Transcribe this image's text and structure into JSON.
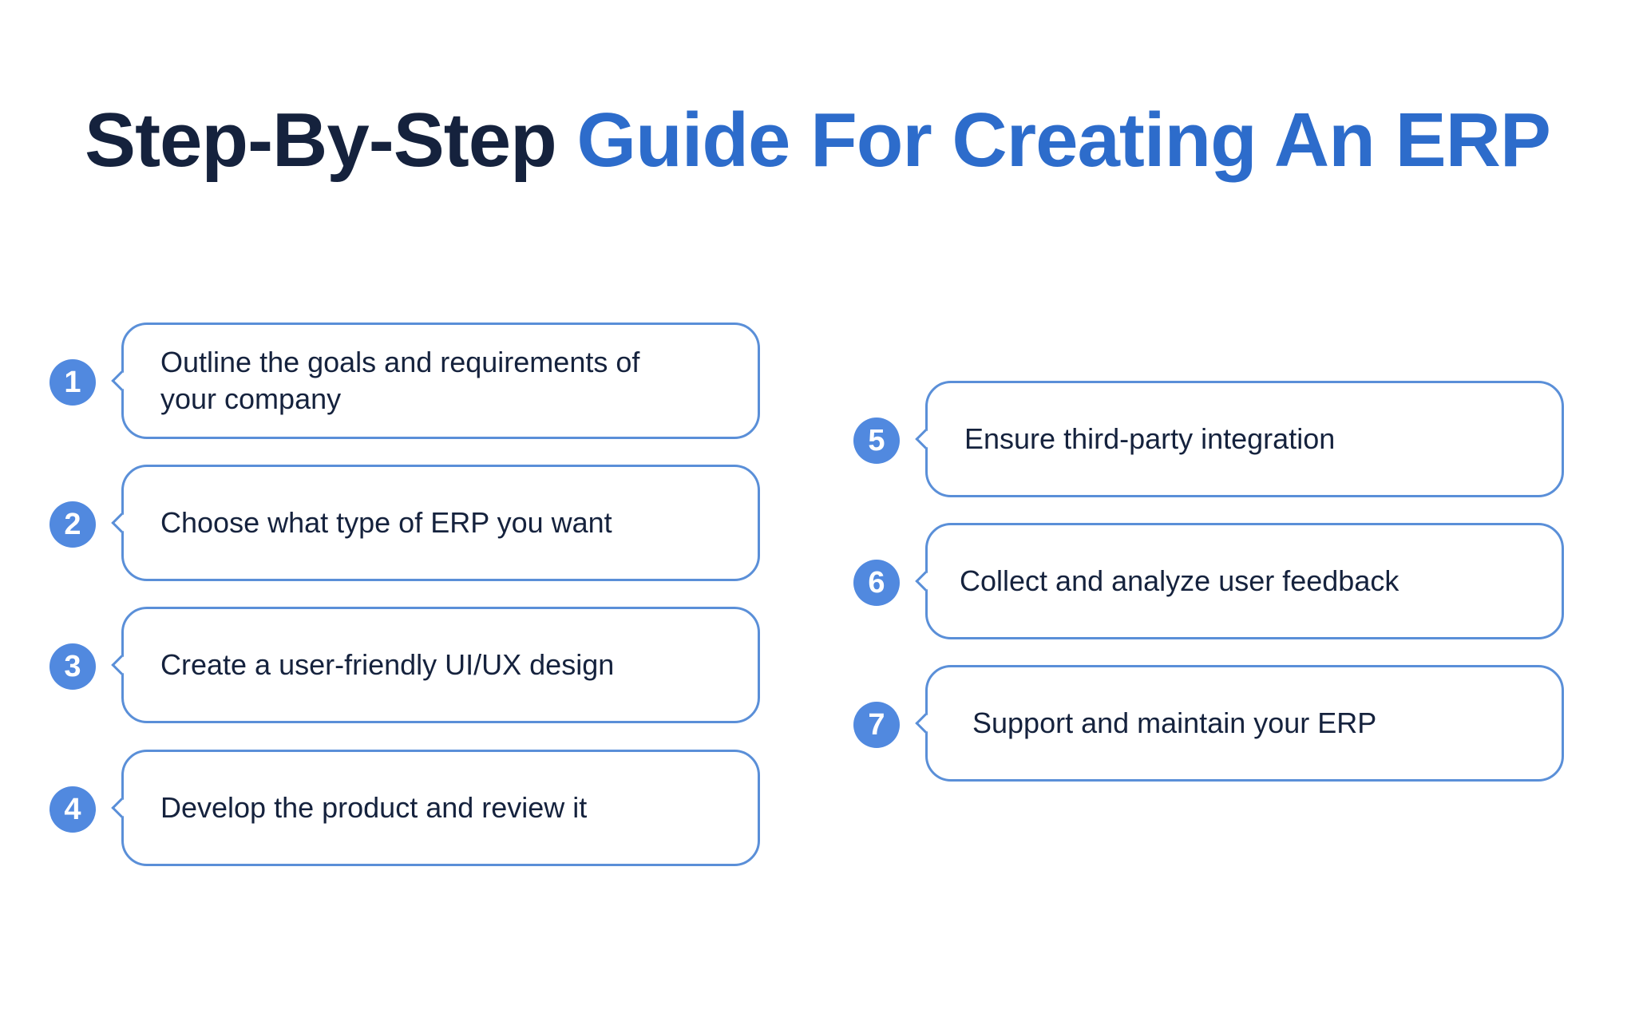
{
  "title": {
    "part1": "Step-By-Step",
    "part2": "Guide For Creating An ERP"
  },
  "colors": {
    "title_dark": "#15223d",
    "title_accent": "#2d6ccb",
    "badge_fill": "#5189df",
    "box_border": "#5a8fd8",
    "body_text": "#15223d"
  },
  "steps": [
    {
      "number": "1",
      "text": "Outline the goals and requirements of your company"
    },
    {
      "number": "2",
      "text": "Choose what type of ERP you want"
    },
    {
      "number": "3",
      "text": "Create a user-friendly UI/UX design"
    },
    {
      "number": "4",
      "text": "Develop the product and review it"
    },
    {
      "number": "5",
      "text": "Ensure third-party integration"
    },
    {
      "number": "6",
      "text": "Collect and analyze user feedback"
    },
    {
      "number": "7",
      "text": "Support and maintain your ERP"
    }
  ]
}
